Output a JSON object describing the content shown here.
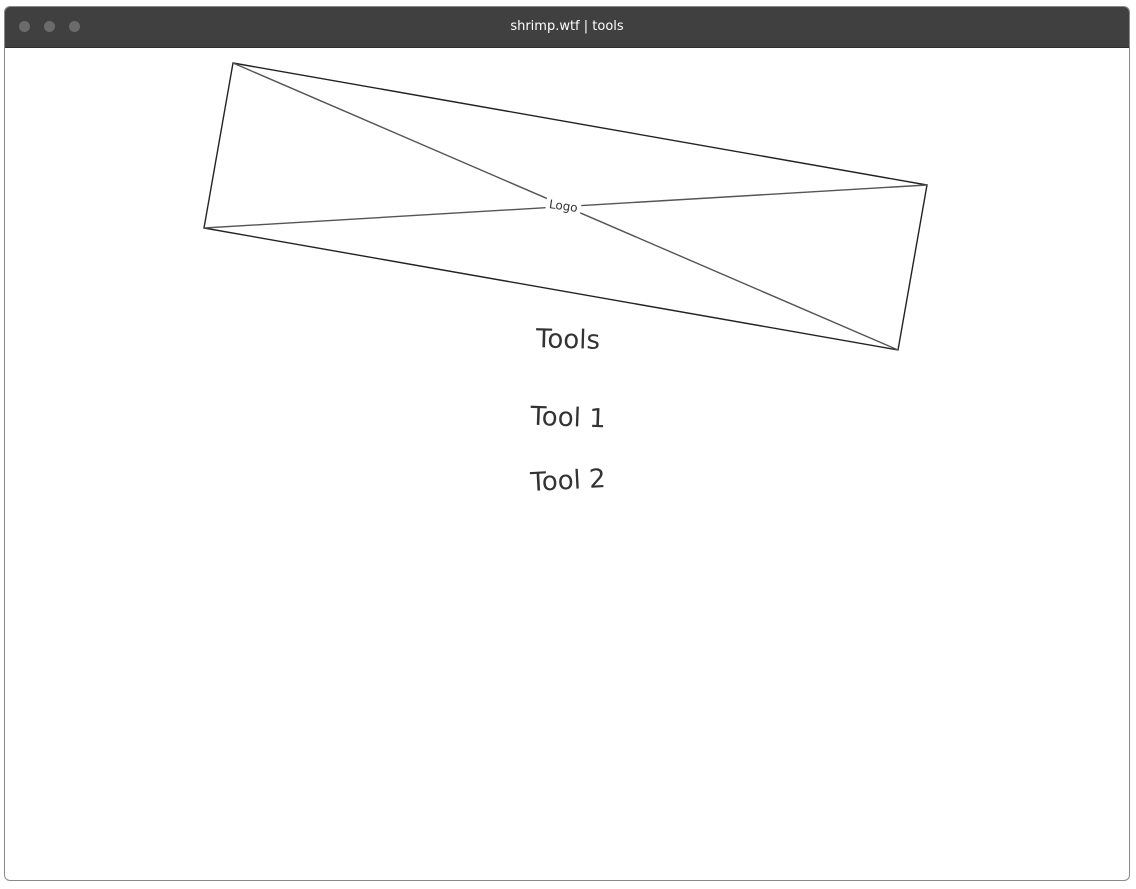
{
  "window": {
    "title": "shrimp.wtf | tools"
  },
  "logo": {
    "label": "Logo"
  },
  "main": {
    "title": "Tools",
    "tools": [
      {
        "label": "Tool 1"
      },
      {
        "label": "Tool 2"
      }
    ]
  }
}
